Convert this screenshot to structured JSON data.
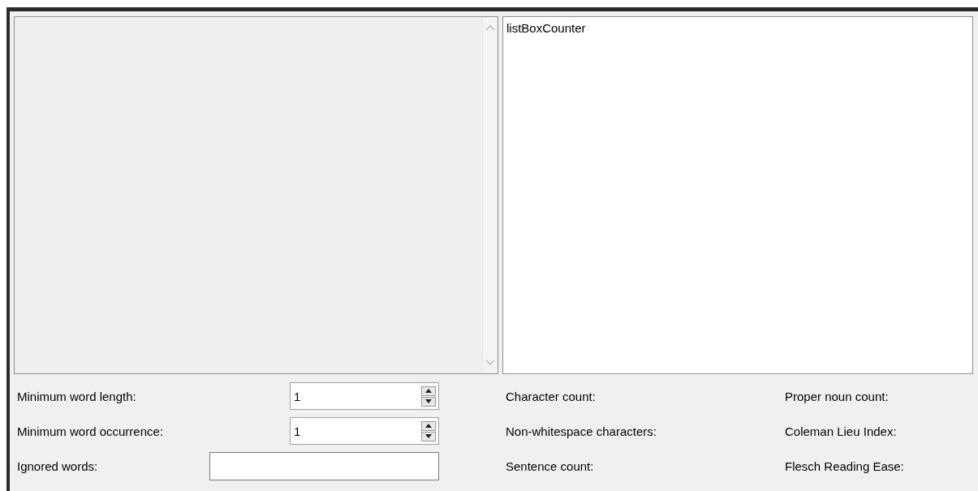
{
  "text_box": {
    "disabled": true
  },
  "list_box": {
    "items": [
      {
        "label": "listBoxCounter"
      }
    ]
  },
  "settings": [
    {
      "kind": "spinner",
      "label": "Minimum word length:",
      "value": "1"
    },
    {
      "kind": "spinner",
      "label": "Minimum word occurrence:",
      "value": "1"
    },
    {
      "kind": "text",
      "label": "Ignored words:"
    }
  ],
  "statistics": [
    {
      "label": "Character count:"
    },
    {
      "label": "Proper noun count:"
    },
    {
      "label": "Non-whitespace characters:"
    },
    {
      "label": "Coleman Lieu Index:"
    },
    {
      "label": "Sentence count:"
    },
    {
      "label": "Flesch Reading Ease:"
    }
  ]
}
